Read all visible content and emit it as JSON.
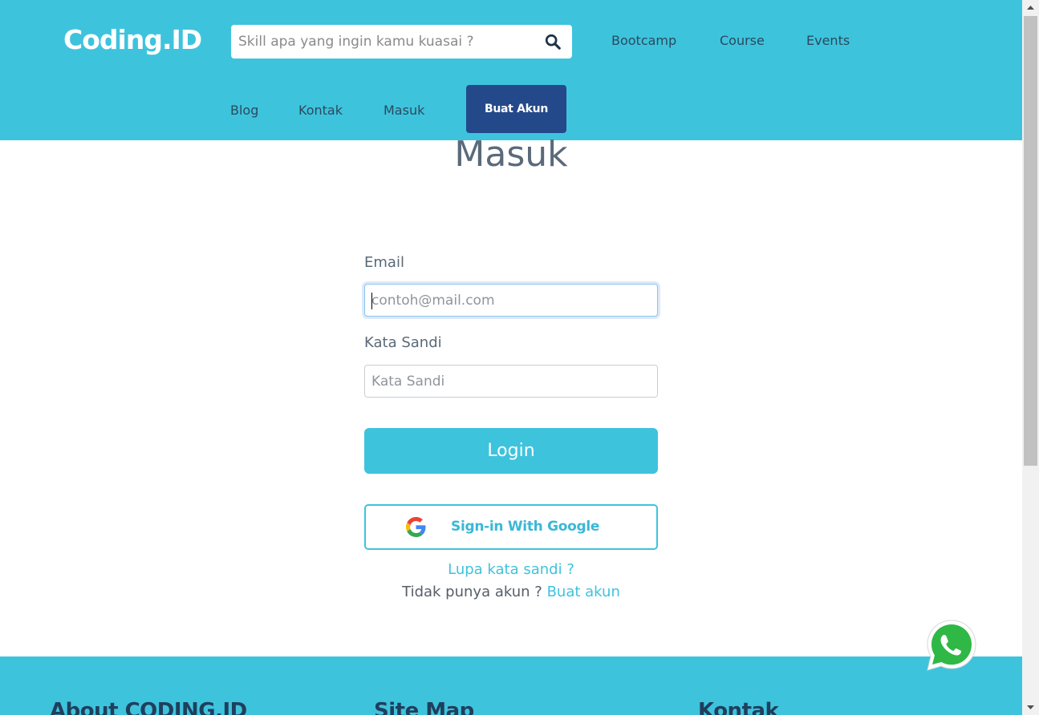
{
  "header": {
    "logo": "Coding.ID",
    "search_placeholder": "Skill apa yang ingin kamu kuasai ?",
    "nav": [
      "Bootcamp",
      "Course",
      "Events",
      "Blog",
      "Kontak",
      "Masuk"
    ],
    "signup_button": "Buat Akun"
  },
  "main": {
    "title": "Masuk",
    "email_label": "Email",
    "email_placeholder": "contoh@mail.com",
    "password_label": "Kata Sandi",
    "password_placeholder": "Kata Sandi",
    "login_button": "Login",
    "google_button": "Sign-in With Google",
    "forgot_link": "Lupa kata sandi ?",
    "no_account_text": "Tidak punya akun ?",
    "create_account_link": "Buat akun"
  },
  "footer": {
    "headings": [
      "About CODING.ID",
      "Site Map",
      "Kontak"
    ]
  },
  "colors": {
    "primary": "#3ec3dd",
    "navy": "#24498a",
    "text": "#5a6a78"
  },
  "icons": {
    "search": "search-icon",
    "google": "google-icon",
    "whatsapp": "whatsapp-icon"
  }
}
